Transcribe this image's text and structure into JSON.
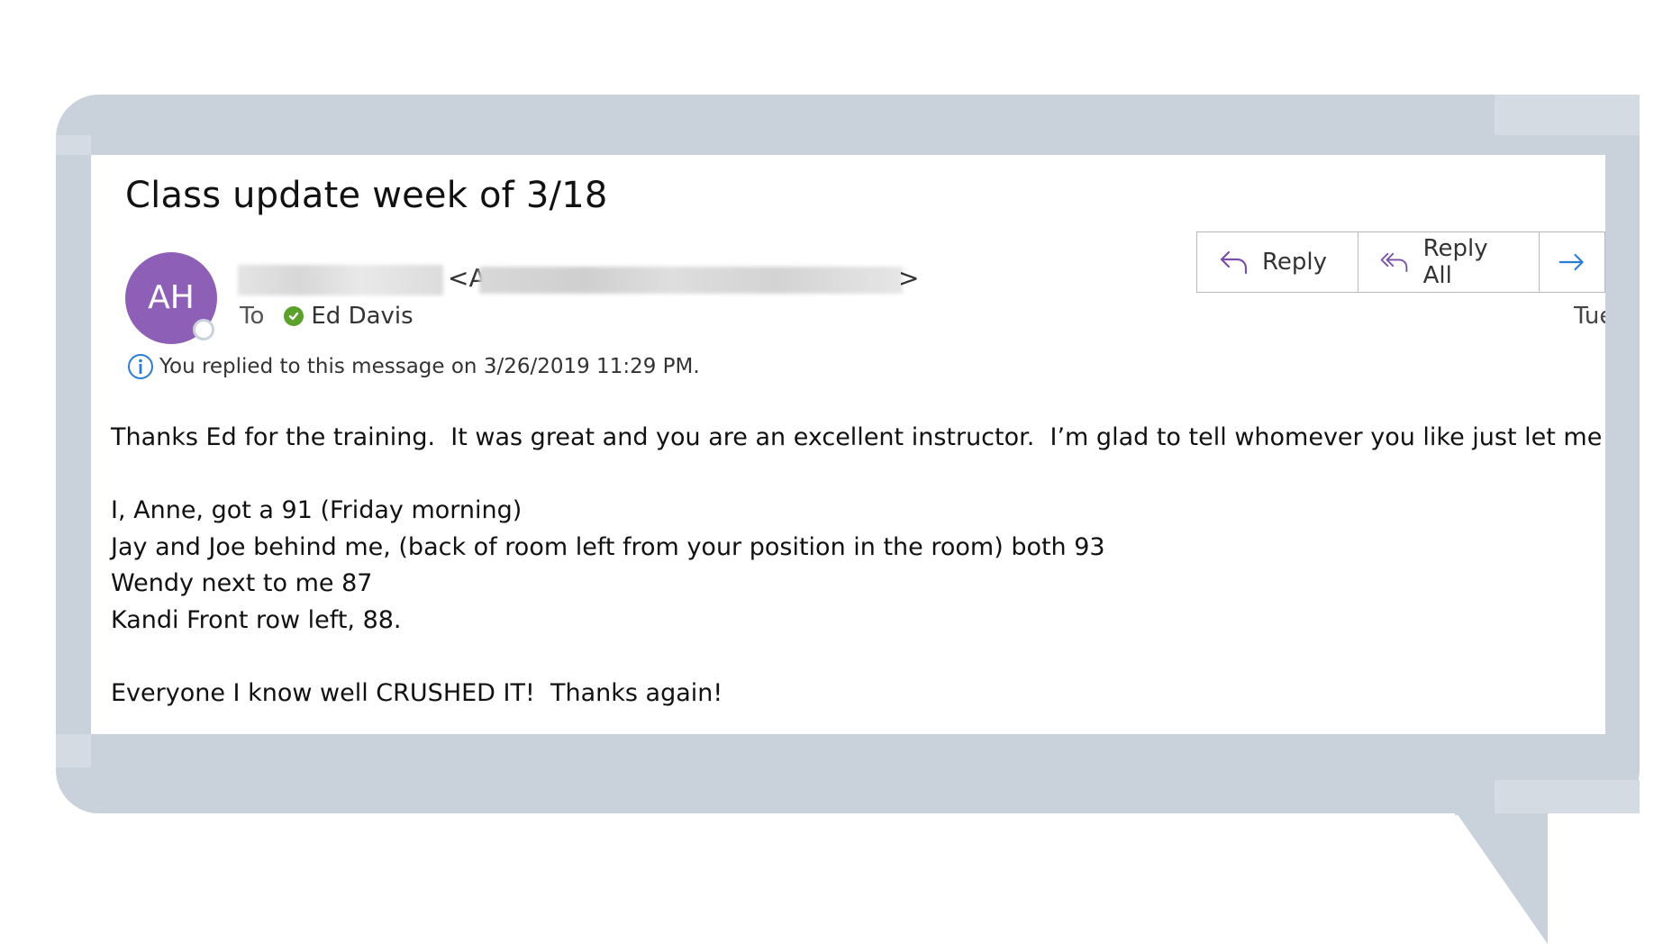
{
  "email": {
    "subject": "Class update week of 3/18",
    "sender": {
      "initials": "AH",
      "avatar_color": "#8e5fb7",
      "email_open": "<A",
      "email_close": ">"
    },
    "to_label": "To",
    "recipient": "Ed Davis",
    "date_partial": "Tue",
    "info_message": "You replied to this message on 3/26/2019 11:29 PM.",
    "actions": {
      "reply_label": "Reply",
      "reply_all_label": "Reply All"
    },
    "body": {
      "line1": "Thanks Ed for the training.  It was great and you are an excellent instructor.  I’m glad to tell whomever you like just let me know!",
      "line2": "I, Anne, got a 91 (Friday morning)",
      "line3": "Jay and Joe behind me, (back of room left from your position in the room) both 93",
      "line4": "Wendy next to me 87",
      "line5": "Kandi Front row left, 88.",
      "line6": "Everyone I know well CRUSHED IT!  Thanks again!"
    }
  },
  "colors": {
    "bubble": "#c9d1da",
    "accent_blue": "#2b7cd3",
    "presence_check": "#5aa12c"
  },
  "icons": [
    "reply-icon",
    "reply-all-icon",
    "forward-icon",
    "info-icon",
    "check-icon"
  ]
}
